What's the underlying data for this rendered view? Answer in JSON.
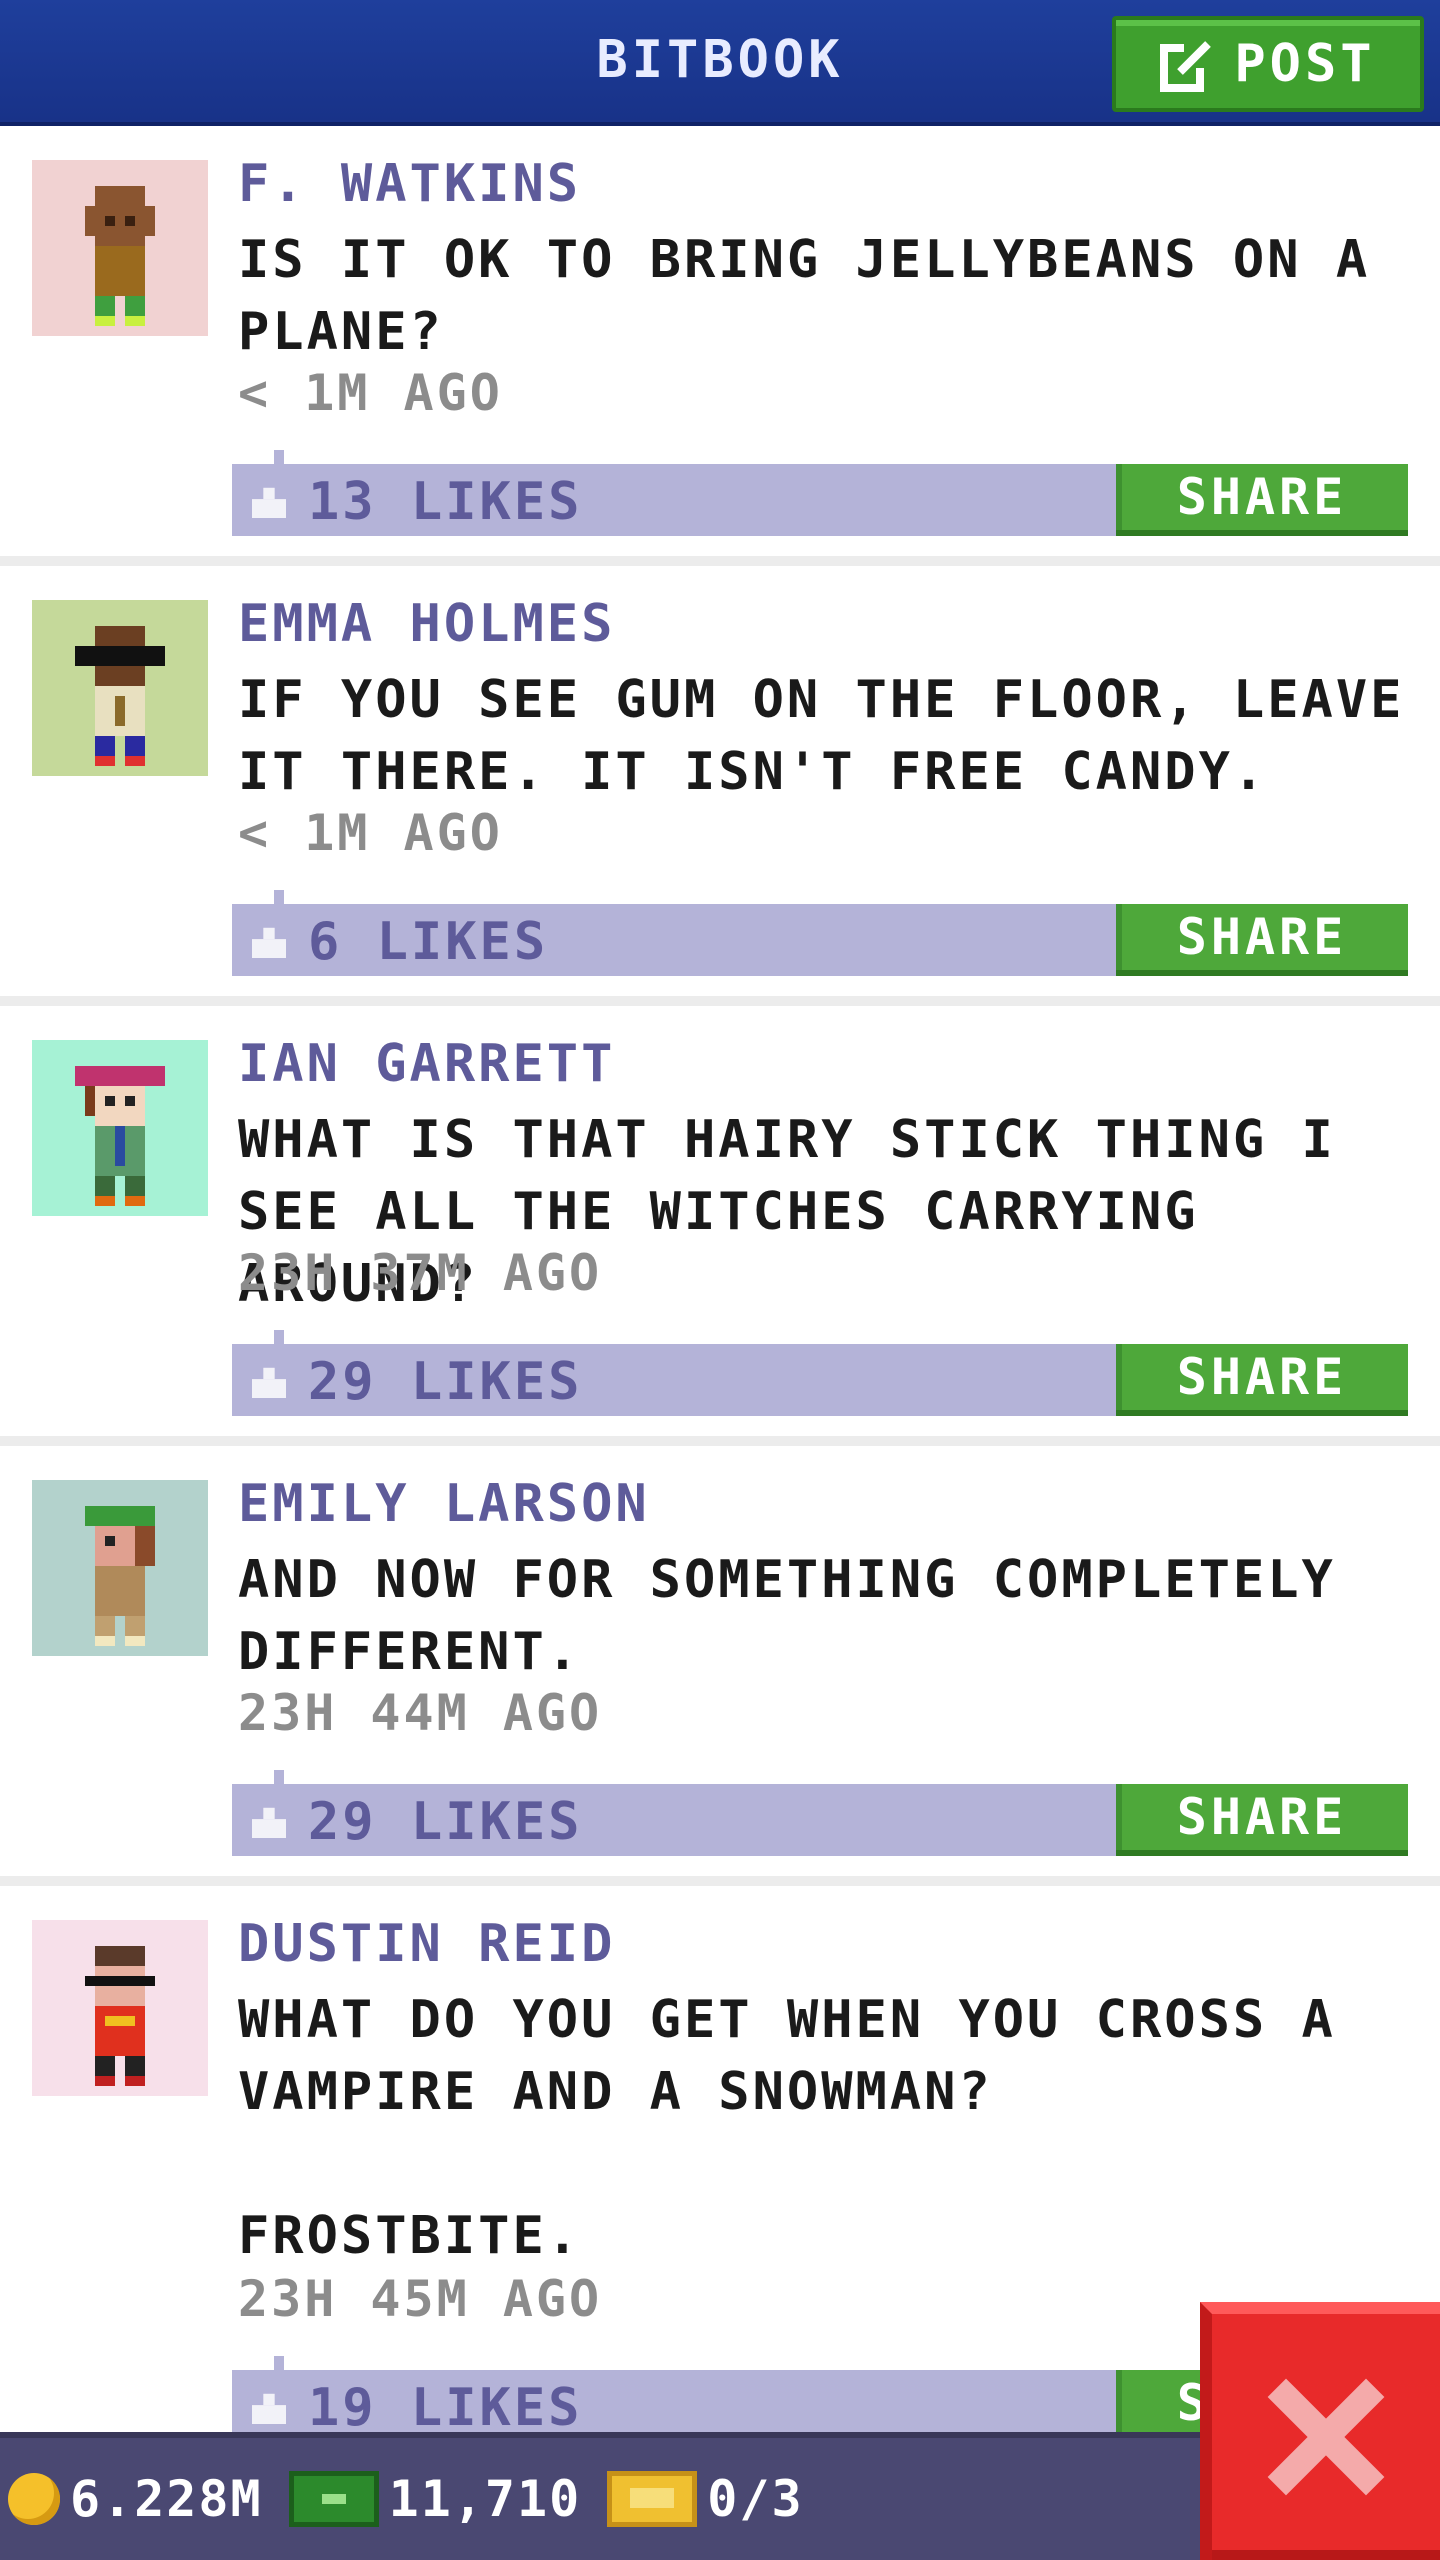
{
  "header": {
    "title": "BITBOOK",
    "post_label": "POST"
  },
  "posts": [
    {
      "author": "F. WATKINS",
      "message": "IS IT OK TO BRING JELLYBEANS ON A PLANE?",
      "time": "< 1M AGO",
      "likes": "13 LIKES",
      "share": "SHARE",
      "avatar_bg": "#f1d2d2"
    },
    {
      "author": "EMMA HOLMES",
      "message": "IF YOU SEE GUM ON THE FLOOR, LEAVE IT THERE. IT ISN'T FREE CANDY.",
      "time": "< 1M AGO",
      "likes": "6 LIKES",
      "share": "SHARE",
      "avatar_bg": "#c5d99a"
    },
    {
      "author": "IAN GARRETT",
      "message": "WHAT IS THAT HAIRY STICK THING I SEE ALL THE WITCHES CARRYING AROUND?",
      "time": "23H 37M AGO",
      "likes": "29 LIKES",
      "share": "SHARE",
      "avatar_bg": "#a6f2d5"
    },
    {
      "author": "EMILY LARSON",
      "message": "AND NOW FOR SOMETHING COMPLETELY DIFFERENT.",
      "time": "23H 44M AGO",
      "likes": "29 LIKES",
      "share": "SHARE",
      "avatar_bg": "#b3d2cc"
    },
    {
      "author": "DUSTIN REID",
      "message": "WHAT DO YOU GET WHEN YOU CROSS A VAMPIRE AND A SNOWMAN?\n\nFROSTBITE.",
      "time": "23H 45M AGO",
      "likes": "19 LIKES",
      "share": "SHARE",
      "avatar_bg": "#f7e0ea"
    }
  ],
  "footer": {
    "coins": "6.228M",
    "bux": "11,710",
    "tickets": "0/3"
  },
  "icons": {
    "post": "edit-icon",
    "like": "thumbs-up-icon",
    "coin": "coin-icon",
    "cash": "cash-icon",
    "ticket": "ticket-icon",
    "close": "close-icon"
  },
  "colors": {
    "header": "#1f3f9c",
    "accent_green": "#4ea83a",
    "likes_bar": "#b4b3d8",
    "author": "#5e5b9a",
    "close": "#e82a2a"
  }
}
